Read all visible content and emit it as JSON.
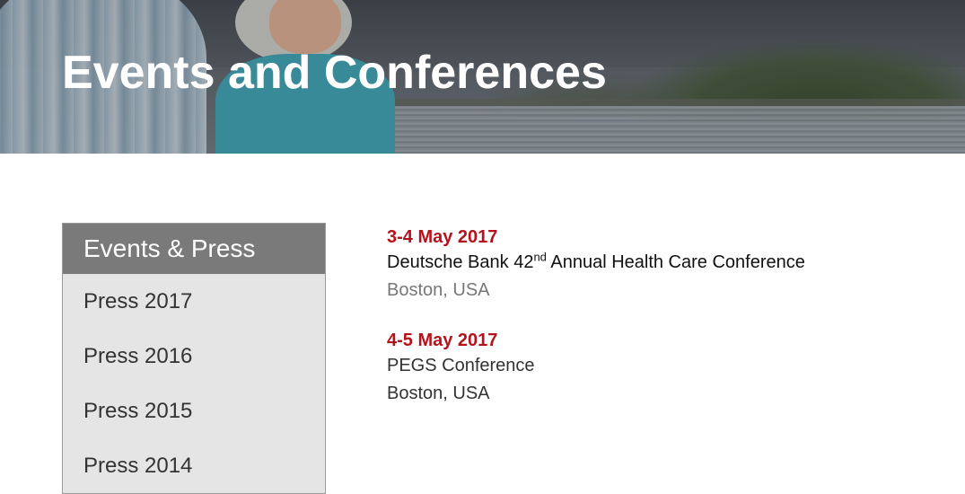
{
  "hero": {
    "title": "Events and Conferences"
  },
  "sidebar": {
    "heading": "Events & Press",
    "items": [
      {
        "label": "Press 2017"
      },
      {
        "label": "Press 2016"
      },
      {
        "label": "Press 2015"
      },
      {
        "label": "Press 2014"
      }
    ]
  },
  "events": [
    {
      "date": "3-4 May 2017",
      "title_before": "Deutsche Bank 42",
      "title_sup": "nd",
      "title_after": " Annual Health Care Conference",
      "location": "Boston, USA"
    },
    {
      "date": "4-5 May 2017",
      "title": "PEGS Conference",
      "location": "Boston, USA"
    }
  ],
  "colors": {
    "date_red": "#b5121b",
    "sidebar_header": "#7a7a7a",
    "sidebar_bg": "#e5e5e5"
  }
}
